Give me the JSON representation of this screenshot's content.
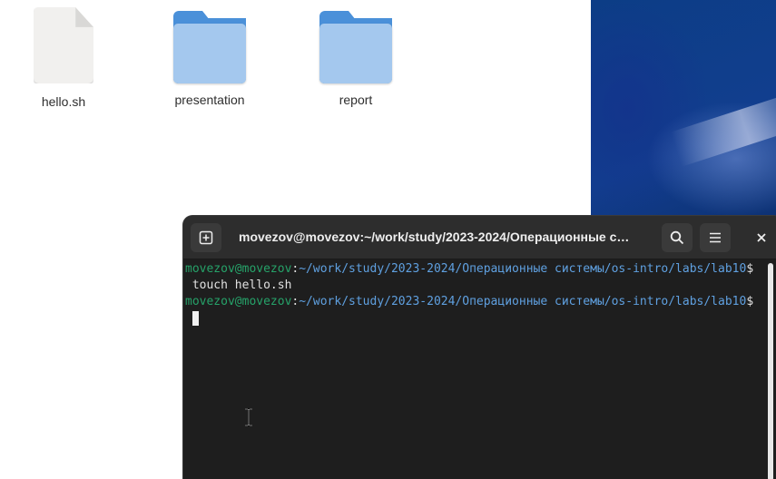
{
  "files": [
    {
      "name": "hello.sh",
      "type": "document"
    },
    {
      "name": "presentation",
      "type": "folder"
    },
    {
      "name": "report",
      "type": "folder"
    }
  ],
  "terminal": {
    "title": "movezov@movezov:~/work/study/2023-2024/Операционные с…",
    "lines": [
      {
        "user": "movezov@movezov",
        "sep": ":",
        "path": "~/work/study/2023-2024/Операционные системы/os-intro/labs/lab10",
        "prompt": "$"
      },
      {
        "command": " touch hello.sh"
      },
      {
        "user": "movezov@movezov",
        "sep": ":",
        "path": "~/work/study/2023-2024/Операционные системы/os-intro/labs/lab10",
        "prompt": "$"
      }
    ],
    "icons": {
      "new_tab": "new-tab-icon",
      "search": "search-icon",
      "menu": "hamburger-menu-icon",
      "close": "close-icon"
    }
  },
  "colors": {
    "prompt_user": "#26a269",
    "prompt_path": "#5fa0e0",
    "terminal_bg": "#1e1e1e",
    "folder": "#a4c8ee"
  }
}
